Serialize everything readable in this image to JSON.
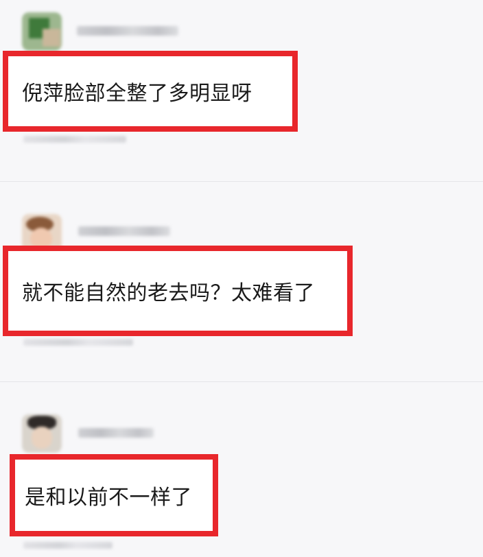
{
  "comments": [
    {
      "text": "倪萍脸部全整了多明显呀"
    },
    {
      "text": "就不能自然的老去吗？太难看了"
    },
    {
      "text": "是和以前不一样了"
    }
  ],
  "colors": {
    "highlight_border": "#e8272c",
    "background": "#f7f7f9",
    "text": "#1a1a1a"
  }
}
